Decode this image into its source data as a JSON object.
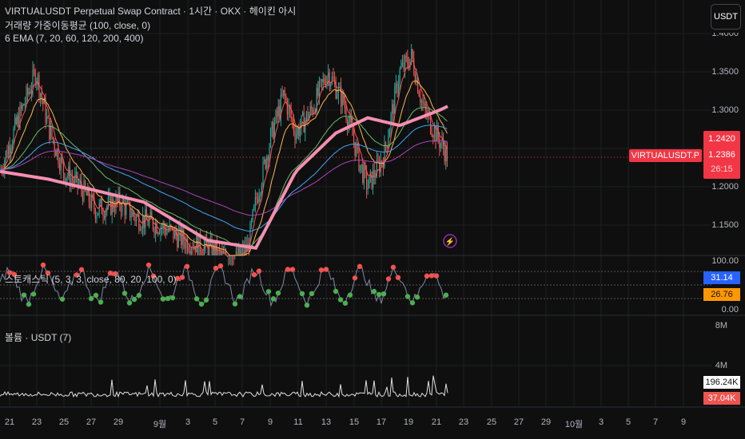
{
  "header": {
    "title": "VIRTUALUSDT Perpetual Swap Contract · 1시간 · OKX · 헤이킨 아시",
    "indicator1": "거래량 가중이동평균 (100, close, 0)",
    "indicator2": "6 EMA (7, 20, 60, 120, 200, 400)",
    "currency_button": "USDT"
  },
  "stoch": {
    "label": "스토캐스틱 (5, 3, 3, close, 80, 20, 100, 0)",
    "k_value": "31.14",
    "d_value": "26.76",
    "axis": [
      "100.00",
      "0.00"
    ]
  },
  "volume": {
    "label": "볼륨 · USDT (7)",
    "axis": [
      "8M",
      "4M"
    ],
    "value1": "196.24K",
    "value2": "37.04K"
  },
  "price_axis": [
    "1.4000",
    "1.3500",
    "1.3000",
    "1.2000",
    "1.1500"
  ],
  "price_tags": {
    "high": "1.2420",
    "symbol": "VIRTUALUSDT.P",
    "last": "1.2386",
    "countdown": "26:15"
  },
  "colors": {
    "up": "#26a69a",
    "down": "#ef5350",
    "ema_thick": "#f48fb1",
    "tag": "#f23645",
    "k": "#2962ff",
    "d": "#ff9800"
  },
  "chart_data": {
    "type": "candlestick",
    "title": "VIRTUALUSDT Perpetual Swap Contract",
    "x_ticks": [
      "21",
      "23",
      "25",
      "27",
      "29",
      "9월",
      "3",
      "5",
      "7",
      "9",
      "11",
      "13",
      "15",
      "17",
      "19",
      "21",
      "23",
      "25",
      "27",
      "29",
      "10월",
      "3",
      "5",
      "7",
      "9"
    ],
    "ylim": [
      1.09,
      1.42
    ],
    "price_path": [
      [
        0,
        1.22
      ],
      [
        20,
        1.28
      ],
      [
        45,
        1.35
      ],
      [
        60,
        1.28
      ],
      [
        80,
        1.22
      ],
      [
        100,
        1.2
      ],
      [
        120,
        1.17
      ],
      [
        150,
        1.18
      ],
      [
        170,
        1.16
      ],
      [
        200,
        1.15
      ],
      [
        230,
        1.13
      ],
      [
        260,
        1.12
      ],
      [
        290,
        1.1
      ],
      [
        310,
        1.12
      ],
      [
        320,
        1.18
      ],
      [
        340,
        1.27
      ],
      [
        355,
        1.32
      ],
      [
        370,
        1.27
      ],
      [
        390,
        1.3
      ],
      [
        410,
        1.35
      ],
      [
        430,
        1.31
      ],
      [
        450,
        1.23
      ],
      [
        460,
        1.2
      ],
      [
        480,
        1.24
      ],
      [
        500,
        1.35
      ],
      [
        515,
        1.37
      ],
      [
        530,
        1.3
      ],
      [
        545,
        1.27
      ],
      [
        560,
        1.24
      ]
    ],
    "ema_thick_path": [
      [
        0,
        1.22
      ],
      [
        60,
        1.21
      ],
      [
        180,
        1.18
      ],
      [
        260,
        1.13
      ],
      [
        320,
        1.12
      ],
      [
        370,
        1.22
      ],
      [
        420,
        1.27
      ],
      [
        460,
        1.29
      ],
      [
        500,
        1.28
      ],
      [
        550,
        1.3
      ],
      [
        560,
        1.305
      ]
    ],
    "last_price": 1.2386
  }
}
